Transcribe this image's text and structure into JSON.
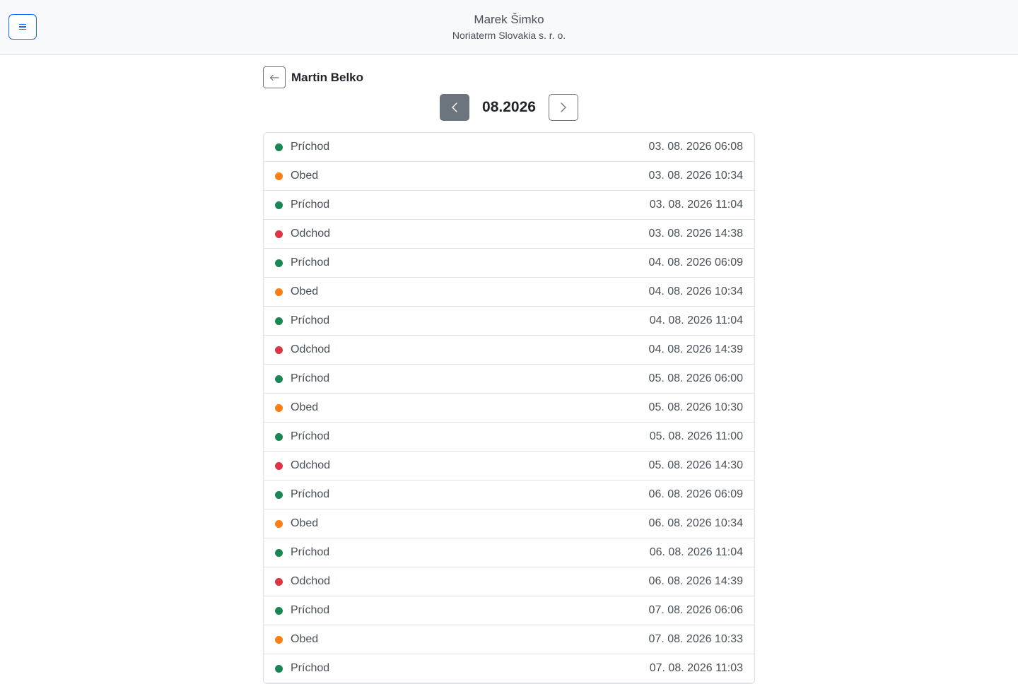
{
  "header": {
    "user_name": "Marek Šimko",
    "company": "Noriaterm Slovakia s. r. o."
  },
  "employee": {
    "name": "Martin Belko"
  },
  "month": {
    "label": "08.2026"
  },
  "colors": {
    "arrival": "#198754",
    "lunch": "#fd7e14",
    "departure": "#dc3545"
  },
  "records": [
    {
      "type": "Príchod",
      "kind": "arrival",
      "time": "03. 08. 2026 06:08"
    },
    {
      "type": "Obed",
      "kind": "lunch",
      "time": "03. 08. 2026 10:34"
    },
    {
      "type": "Príchod",
      "kind": "arrival",
      "time": "03. 08. 2026 11:04"
    },
    {
      "type": "Odchod",
      "kind": "departure",
      "time": "03. 08. 2026 14:38"
    },
    {
      "type": "Príchod",
      "kind": "arrival",
      "time": "04. 08. 2026 06:09"
    },
    {
      "type": "Obed",
      "kind": "lunch",
      "time": "04. 08. 2026 10:34"
    },
    {
      "type": "Príchod",
      "kind": "arrival",
      "time": "04. 08. 2026 11:04"
    },
    {
      "type": "Odchod",
      "kind": "departure",
      "time": "04. 08. 2026 14:39"
    },
    {
      "type": "Príchod",
      "kind": "arrival",
      "time": "05. 08. 2026 06:00"
    },
    {
      "type": "Obed",
      "kind": "lunch",
      "time": "05. 08. 2026 10:30"
    },
    {
      "type": "Príchod",
      "kind": "arrival",
      "time": "05. 08. 2026 11:00"
    },
    {
      "type": "Odchod",
      "kind": "departure",
      "time": "05. 08. 2026 14:30"
    },
    {
      "type": "Príchod",
      "kind": "arrival",
      "time": "06. 08. 2026 06:09"
    },
    {
      "type": "Obed",
      "kind": "lunch",
      "time": "06. 08. 2026 10:34"
    },
    {
      "type": "Príchod",
      "kind": "arrival",
      "time": "06. 08. 2026 11:04"
    },
    {
      "type": "Odchod",
      "kind": "departure",
      "time": "06. 08. 2026 14:39"
    },
    {
      "type": "Príchod",
      "kind": "arrival",
      "time": "07. 08. 2026 06:06"
    },
    {
      "type": "Obed",
      "kind": "lunch",
      "time": "07. 08. 2026 10:33"
    },
    {
      "type": "Príchod",
      "kind": "arrival",
      "time": "07. 08. 2026 11:03"
    }
  ]
}
